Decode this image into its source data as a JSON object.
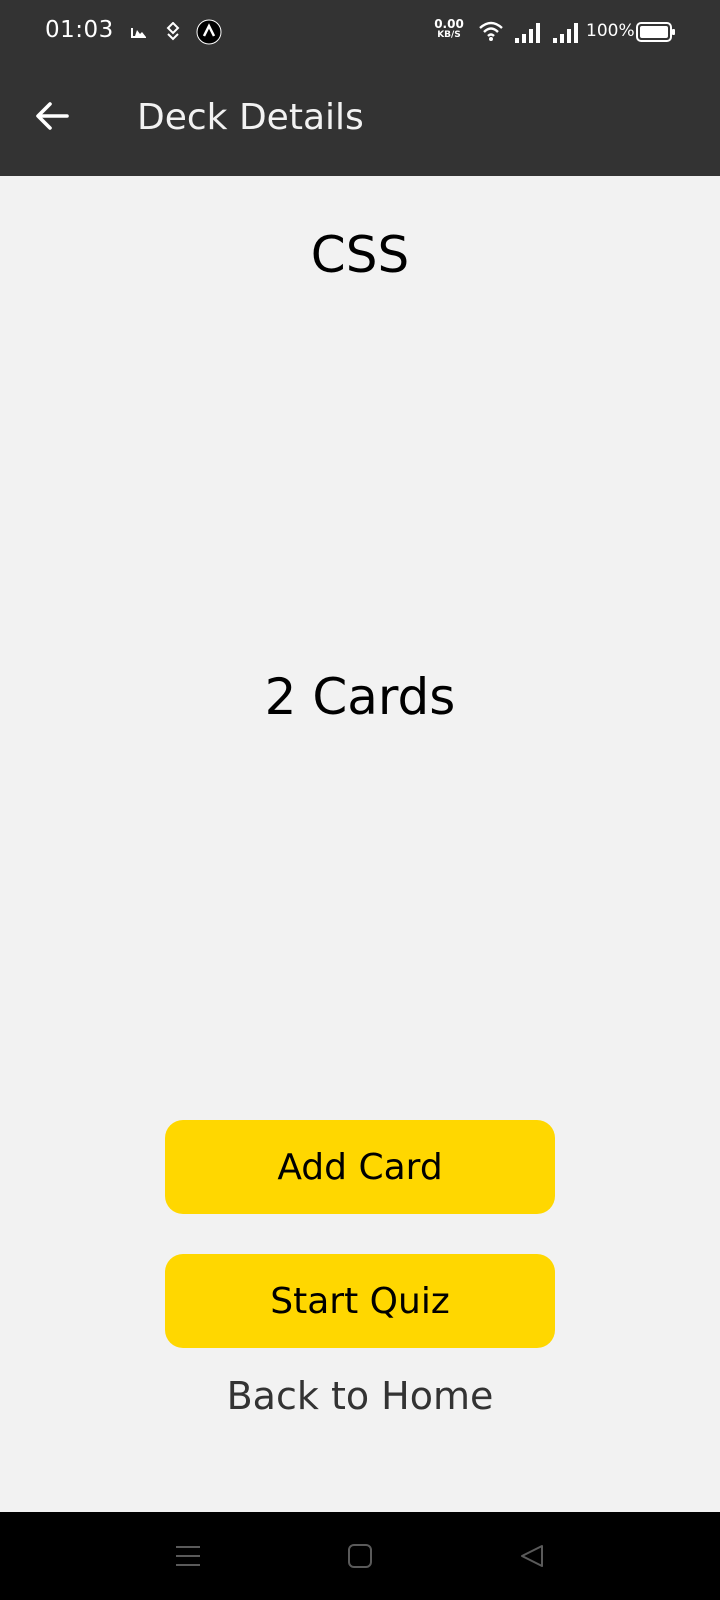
{
  "status_bar": {
    "time": "01:03",
    "net_speed_value": "0.00",
    "net_speed_unit": "KB/S",
    "battery_percent": "100%",
    "icons": [
      "gallery-icon",
      "app-notification-icon",
      "navigation-icon",
      "wifi-icon",
      "signal-icon",
      "signal-icon",
      "battery-icon"
    ]
  },
  "app_bar": {
    "back_icon": "arrow-left-icon",
    "title": "Deck Details"
  },
  "deck": {
    "title": "CSS",
    "card_count": "2 Cards"
  },
  "actions": {
    "add_card_label": "Add Card",
    "start_quiz_label": "Start Quiz",
    "back_home_label": "Back to Home"
  },
  "colors": {
    "header": "#333333",
    "background": "#f2f2f2",
    "button": "#ffd700"
  },
  "nav_bar": {
    "icons": [
      "menu-icon",
      "home-square-icon",
      "back-triangle-icon"
    ]
  }
}
